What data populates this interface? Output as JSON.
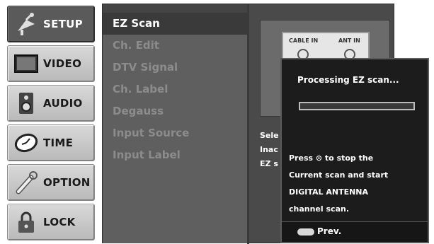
{
  "tabs": [
    {
      "label": "SETUP",
      "icon": "satellite-icon",
      "active": true
    },
    {
      "label": "VIDEO",
      "icon": "monitor-icon",
      "active": false
    },
    {
      "label": "AUDIO",
      "icon": "speaker-icon",
      "active": false
    },
    {
      "label": "TIME",
      "icon": "clock-icon",
      "active": false
    },
    {
      "label": "OPTION",
      "icon": "wrench-icon",
      "active": false
    },
    {
      "label": "LOCK",
      "icon": "padlock-icon",
      "active": false
    }
  ],
  "menu": {
    "items": [
      {
        "label": "EZ Scan",
        "selected": true
      },
      {
        "label": "Ch. Edit",
        "selected": false
      },
      {
        "label": "DTV Signal",
        "selected": false
      },
      {
        "label": "Ch. Label",
        "selected": false
      },
      {
        "label": "Degauss",
        "selected": false
      },
      {
        "label": "Input Source",
        "selected": false
      },
      {
        "label": "Input Label",
        "selected": false
      }
    ]
  },
  "illustration": {
    "cable_in": "CABLE IN",
    "ant_in": "ANT IN"
  },
  "info": {
    "line1": "Sele",
    "line2": "Inac",
    "line3": "EZ s"
  },
  "popup": {
    "title": "Processing EZ scan...",
    "progress_fraction": 0.0,
    "message_line1": "Press ⊙ to stop the",
    "message_line2": "Current scan and start",
    "message_line3": "DIGITAL ANTENNA",
    "message_line4": "channel scan.",
    "prev_label": "Prev.",
    "prev_key_icon": "menu-key-icon"
  },
  "colors": {
    "panel_bg": "#4a4a4a",
    "menu_bg": "#5f5f5f",
    "popup_bg": "#1c1c1c",
    "tab_active_bg": "#5a5a5a",
    "tab_bg": "#c9c9c9"
  }
}
